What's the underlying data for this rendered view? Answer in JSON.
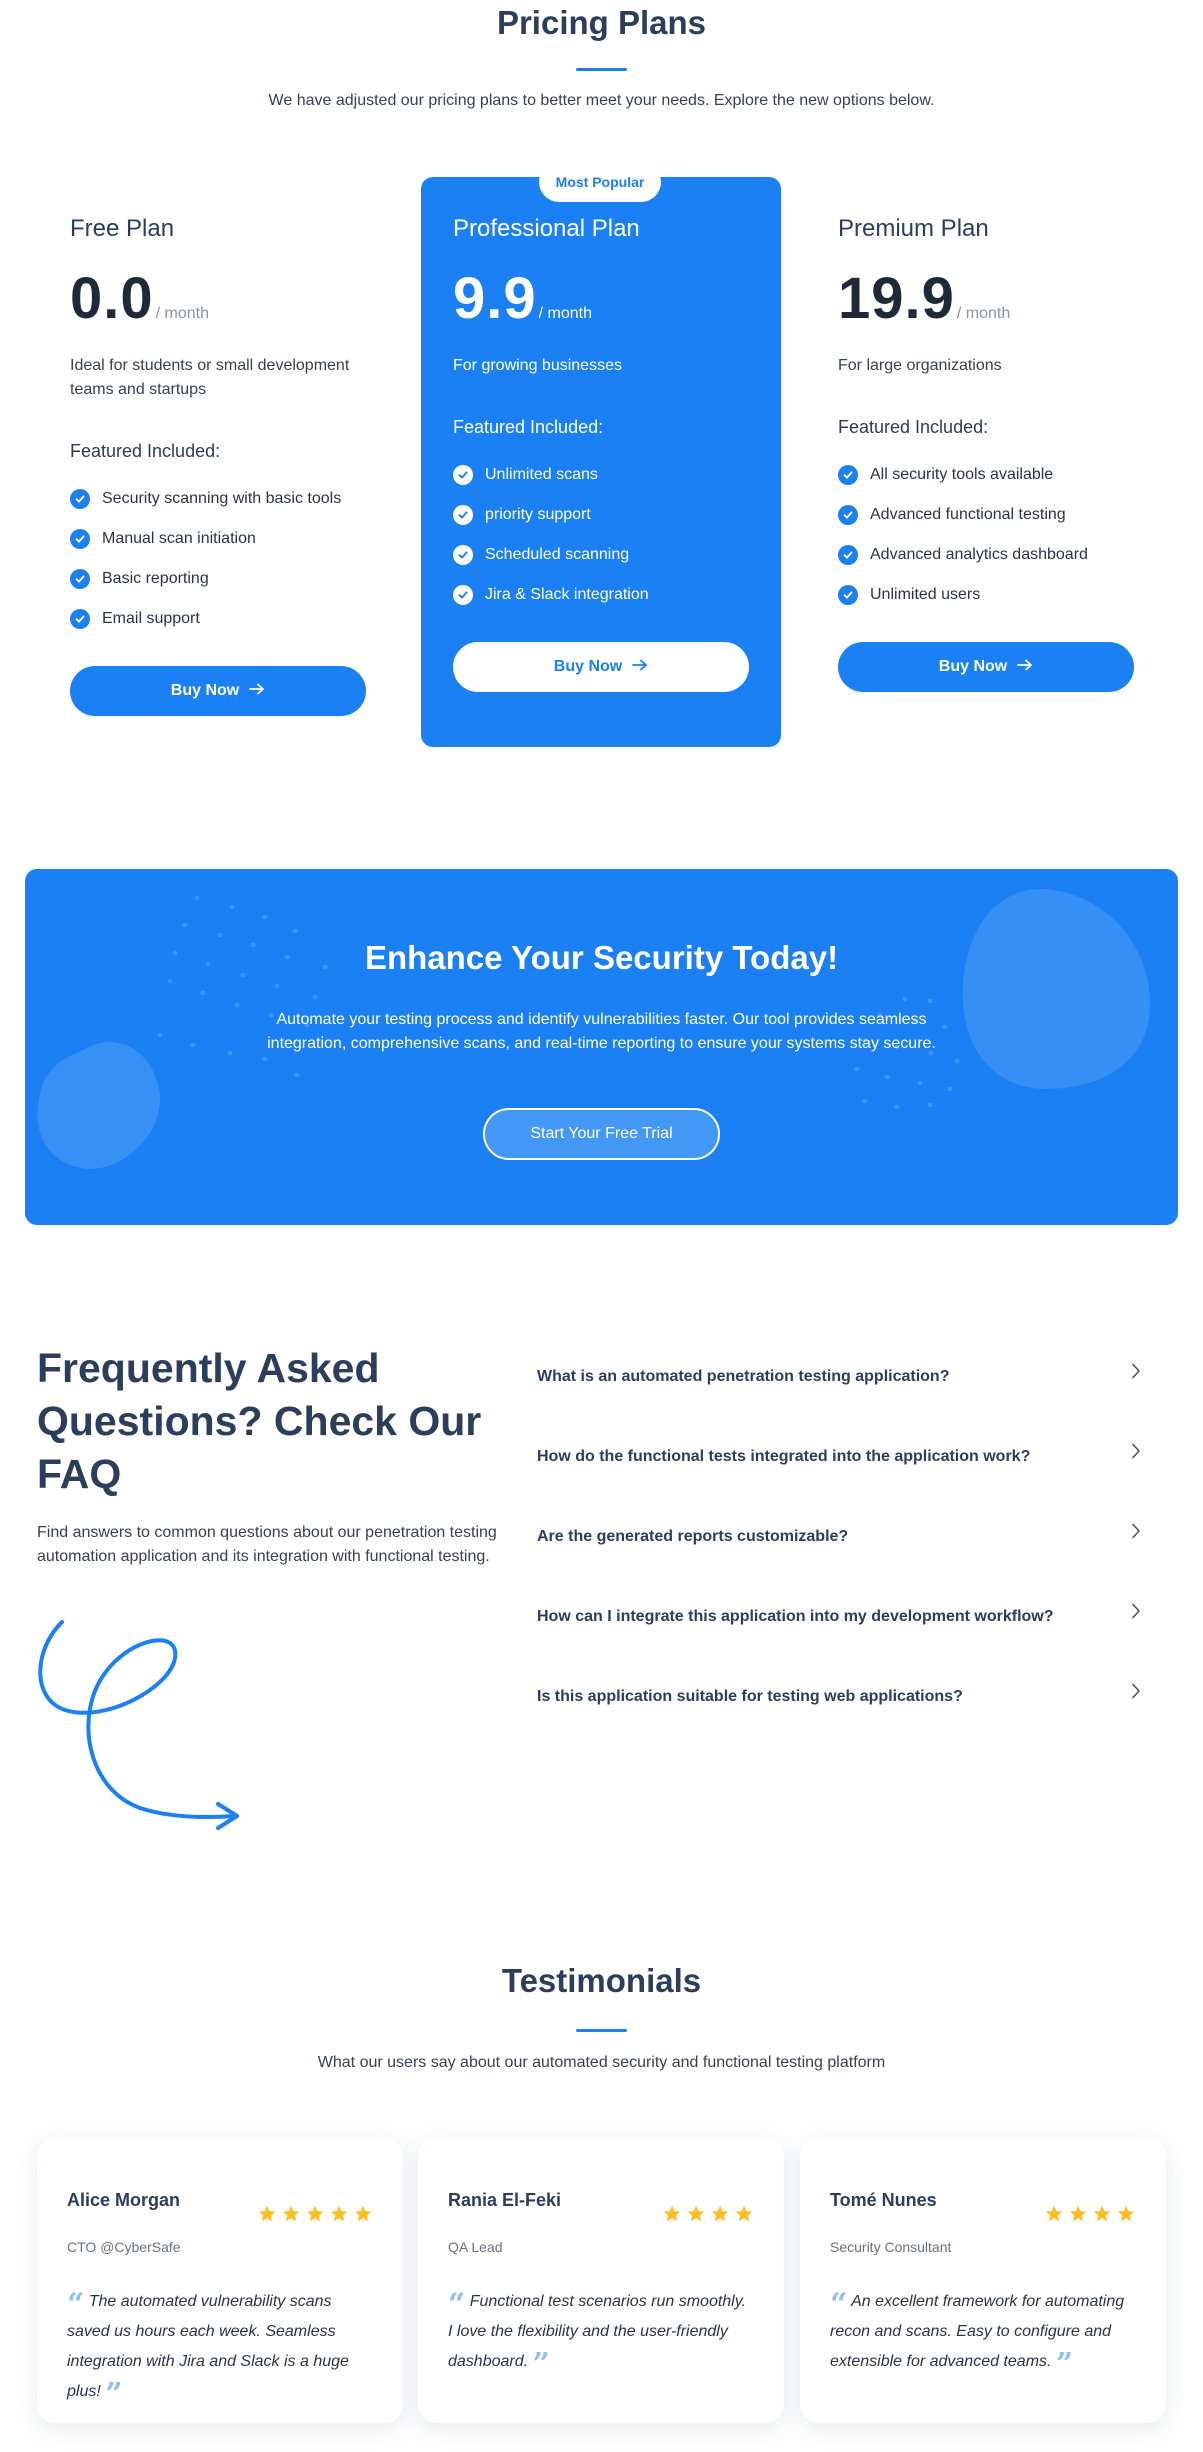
{
  "pricing": {
    "title": "Pricing Plans",
    "subtitle": "We have adjusted our pricing plans to better meet your needs. Explore the new options below.",
    "plans": [
      {
        "name": "Free Plan",
        "price": "0.0",
        "unit": "/ month",
        "description": "Ideal for students or small development teams and startups",
        "features_title": "Featured Included:",
        "features": [
          "Security scanning with basic tools",
          "Manual scan initiation",
          "Basic reporting",
          "Email support"
        ],
        "button": "Buy Now"
      },
      {
        "name": "Professional Plan",
        "price": "9.9",
        "unit": "/ month",
        "badge": "Most Popular",
        "description": "For growing businesses",
        "features_title": "Featured Included:",
        "features": [
          "Unlimited scans",
          "priority support",
          "Scheduled scanning",
          "Jira & Slack integration"
        ],
        "button": "Buy Now"
      },
      {
        "name": "Premium Plan",
        "price": "19.9",
        "unit": "/ month",
        "description": "For large organizations",
        "features_title": "Featured Included:",
        "features": [
          "All security tools available",
          "Advanced functional testing",
          "Advanced analytics dashboard",
          "Unlimited users"
        ],
        "button": "Buy Now"
      }
    ]
  },
  "cta": {
    "title": "Enhance Your Security Today!",
    "text": "Automate your testing process and identify vulnerabilities faster. Our tool provides seamless integration, comprehensive scans, and real-time reporting to ensure your systems stay secure.",
    "button": "Start Your Free Trial"
  },
  "faq": {
    "title": "Frequently Asked Questions? Check Our FAQ",
    "subtitle": "Find answers to common questions about our penetration testing automation application and its integration with functional testing.",
    "items": [
      "What is an automated penetration testing application?",
      "How do the functional tests integrated into the application work?",
      "Are the generated reports customizable?",
      "How can I integrate this application into my development workflow?",
      "Is this application suitable for testing web applications?"
    ]
  },
  "testimonials": {
    "title": "Testimonials",
    "subtitle": "What our users say about our automated security and functional testing platform",
    "items": [
      {
        "name": "Alice Morgan",
        "role": "CTO @CyberSafe",
        "rating": 5,
        "quote": "The automated vulnerability scans saved us hours each week. Seamless integration with Jira and Slack is a huge plus!"
      },
      {
        "name": "Rania El-Feki",
        "role": "QA Lead",
        "rating": 4,
        "quote": "Functional test scenarios run smoothly. I love the flexibility and the user-friendly dashboard."
      },
      {
        "name": "Tomé Nunes",
        "role": "Security Consultant",
        "rating": 4,
        "quote": "An excellent framework for automating recon and scans. Easy to configure and extensible for advanced teams."
      }
    ]
  },
  "colors": {
    "primary": "#1a80f3",
    "heading": "#2c3e5c",
    "star": "#fbbf24",
    "quote_mark": "#8ec0f5"
  },
  "icons": {
    "feature": "check-circle-icon",
    "buy": "arrow-right-icon",
    "faq": "chevron-right-icon",
    "rating": "star-icon",
    "decor": "curly-arrow-icon"
  }
}
